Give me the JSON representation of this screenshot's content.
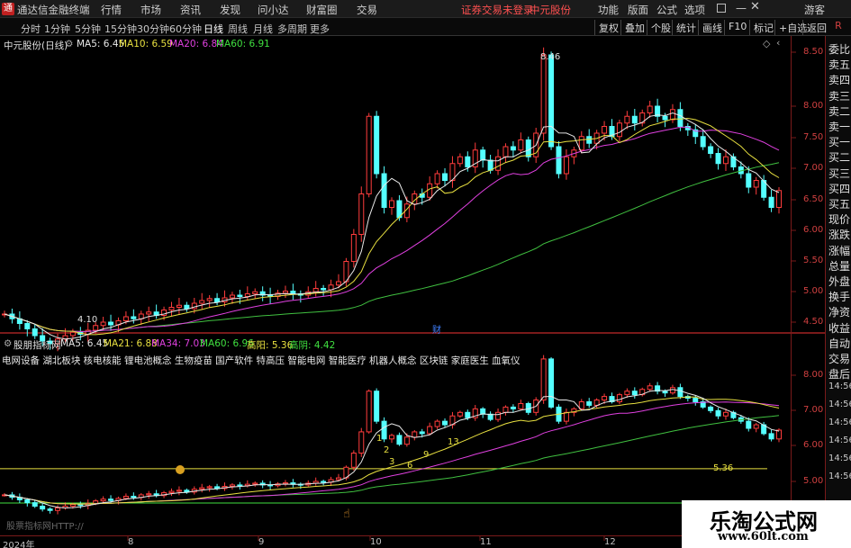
{
  "titlebar": {
    "app": "通达信金融终端",
    "menus": [
      "行情",
      "市场",
      "资讯",
      "发现",
      "问小达",
      "财富圈",
      "交易"
    ],
    "notice": "证券交易未登录",
    "stock": "中元股份",
    "right_menus": [
      "功能",
      "版面",
      "公式",
      "选项"
    ],
    "guest": "游客"
  },
  "toolbar": {
    "periods": [
      "分时",
      "1分钟",
      "5分钟",
      "15分钟",
      "30分钟",
      "60分钟",
      "日线",
      "周线",
      "月线",
      "多周期",
      "更多"
    ],
    "active_period": "日线",
    "buttons": [
      "复权",
      "叠加",
      "个股",
      "统计",
      "画线",
      "F10",
      "标记",
      "+自选",
      "返回"
    ]
  },
  "main_chart": {
    "title": "中元股份(日线)",
    "ma": [
      {
        "label": "MA5: 6.45",
        "color": "#e8e8e8"
      },
      {
        "label": "MA10: 6.59",
        "color": "#e8e040"
      },
      {
        "label": "MA20: 6.84",
        "color": "#e040e0"
      },
      {
        "label": "MA60: 6.91",
        "color": "#40e040"
      }
    ],
    "high_label": "8.46",
    "low_label": "4.10",
    "marker": "财",
    "y_ticks": [
      "8.50",
      "8.00",
      "7.50",
      "7.00",
      "6.50",
      "6.00",
      "5.50",
      "5.00",
      "4.50"
    ]
  },
  "sub_chart": {
    "title": "股朋指标网",
    "ma": [
      {
        "label": "MA5: 6.45",
        "color": "#e8e8e8"
      },
      {
        "label": "MA21: 6.88",
        "color": "#e8e040"
      },
      {
        "label": "MA34: 7.03",
        "color": "#e040e0"
      },
      {
        "label": "MA60: 6.96",
        "color": "#40e040"
      },
      {
        "label": "高阳: 5.36",
        "color": "#e8e040"
      },
      {
        "label": "高阴: 4.42",
        "color": "#40e040"
      }
    ],
    "concepts": "电网设备 湖北板块 核电核能 锂电池概念 生物疫苗 国产软件 特高压 智能电网 智能医疗 机器人概念 区块链 家庭医生 血氧仪",
    "counts": [
      "1",
      "2",
      "3",
      "6",
      "9",
      "13"
    ],
    "level_label": "5.36",
    "url_text": "股票指标网HTTP://",
    "y_ticks": [
      "8.00",
      "7.00",
      "6.00",
      "5.00"
    ]
  },
  "right_panel": [
    "委比",
    "卖五",
    "卖四",
    "卖三",
    "卖二",
    "卖一",
    "买一",
    "买二",
    "买三",
    "买四",
    "买五",
    "现价",
    "涨跌",
    "涨幅",
    "总量",
    "外盘",
    "换手",
    "净资",
    "收益",
    "自动",
    "交易",
    "盘后",
    "14:56",
    "14:56",
    "14:56",
    "14:56",
    "14:56",
    "14:56"
  ],
  "dates": [
    "2024年",
    "8",
    "9",
    "10",
    "11",
    "12"
  ],
  "watermark": {
    "name": "乐淘公式网",
    "url": "www.60lt.com"
  },
  "chart_data": {
    "type": "candlestick",
    "close": [
      4.62,
      4.55,
      4.48,
      4.4,
      4.3,
      4.22,
      4.18,
      4.25,
      4.3,
      4.35,
      4.32,
      4.38,
      4.45,
      4.5,
      4.46,
      4.52,
      4.58,
      4.55,
      4.62,
      4.65,
      4.6,
      4.68,
      4.72,
      4.75,
      4.7,
      4.78,
      4.82,
      4.85,
      4.8,
      4.86,
      4.9,
      4.88,
      4.92,
      4.95,
      4.9,
      4.88,
      4.93,
      4.96,
      4.92,
      4.9,
      4.95,
      5.0,
      4.98,
      5.05,
      5.1,
      5.4,
      5.8,
      6.4,
      7.55,
      6.7,
      6.2,
      6.3,
      6.05,
      6.25,
      6.4,
      6.35,
      6.55,
      6.7,
      6.6,
      6.85,
      6.95,
      6.8,
      7.05,
      6.9,
      6.75,
      6.95,
      7.1,
      7.05,
      7.2,
      6.95,
      7.3,
      8.46,
      7.1,
      6.7,
      6.95,
      7.05,
      7.25,
      7.15,
      7.3,
      7.4,
      7.25,
      7.45,
      7.55,
      7.45,
      7.6,
      7.7,
      7.55,
      7.5,
      7.65,
      7.4,
      7.35,
      7.25,
      7.1,
      7.0,
      6.85,
      6.95,
      6.8,
      6.7,
      6.5,
      6.6,
      6.35,
      6.2,
      6.45
    ],
    "y_range": [
      4.2,
      8.6
    ],
    "ma_labels": [
      "MA5",
      "MA10",
      "MA20",
      "MA60"
    ]
  }
}
